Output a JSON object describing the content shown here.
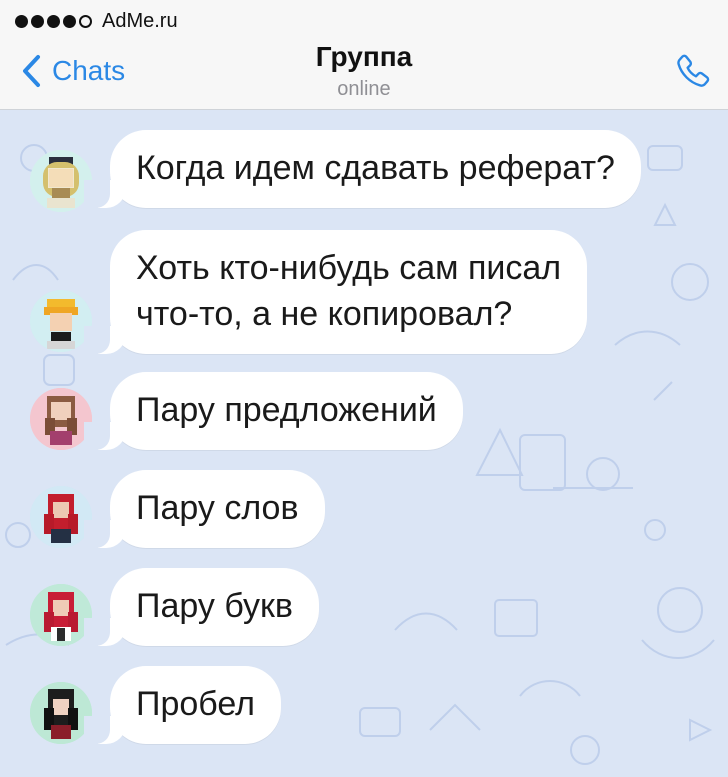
{
  "status_bar": {
    "carrier": "AdMe.ru",
    "signal_level": "4 of 5"
  },
  "header": {
    "back_label": "Chats",
    "title": "Группа",
    "subtitle": "online",
    "back_icon": "chevron-left-icon",
    "call_icon": "phone-icon"
  },
  "colors": {
    "accent": "#2b88e5",
    "chat_background": "#dbe5f5",
    "bubble": "#ffffff",
    "header_background": "#f7f7f7"
  },
  "messages": [
    {
      "avatar": "gold-helmet-avatar",
      "lines": [
        "Когда идем сдавать реферат?"
      ]
    },
    {
      "avatar": "blonde-avatar",
      "lines": [
        "Хоть кто-нибудь сам писал",
        "что-то, а не копировал?"
      ]
    },
    {
      "avatar": "brunette-avatar",
      "lines": [
        "Пару предложений"
      ]
    },
    {
      "avatar": "red-hair-avatar",
      "lines": [
        "Пару слов"
      ]
    },
    {
      "avatar": "red-hair-avatar-2",
      "lines": [
        "Пару букв"
      ]
    },
    {
      "avatar": "dark-hair-avatar",
      "lines": [
        "Пробел"
      ]
    }
  ]
}
